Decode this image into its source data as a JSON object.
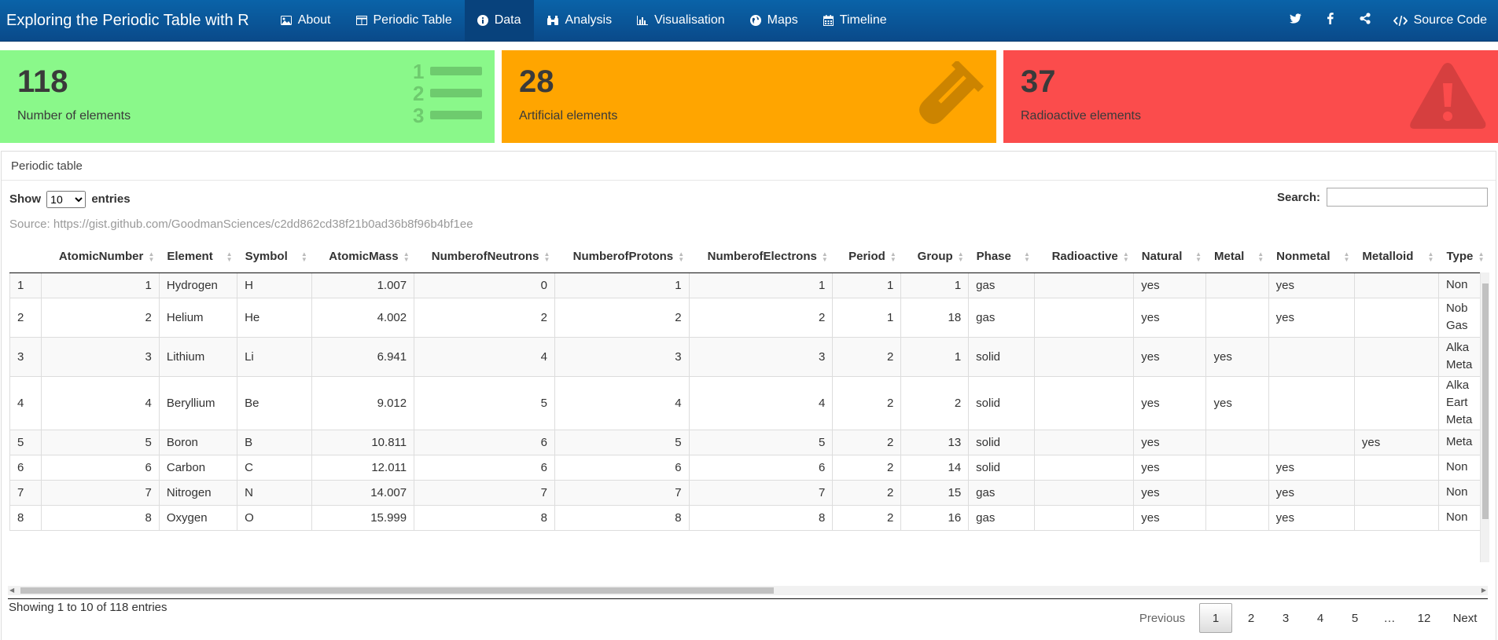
{
  "app": {
    "title": "Exploring the Periodic Table with R"
  },
  "nav": {
    "items": [
      {
        "label": "About",
        "icon": "image-icon"
      },
      {
        "label": "Periodic Table",
        "icon": "table-icon"
      },
      {
        "label": "Data",
        "icon": "info-circle-icon",
        "active": true
      },
      {
        "label": "Analysis",
        "icon": "binoculars-icon"
      },
      {
        "label": "Visualisation",
        "icon": "bar-chart-icon"
      },
      {
        "label": "Maps",
        "icon": "globe-icon"
      },
      {
        "label": "Timeline",
        "icon": "calendar-icon"
      }
    ],
    "right": {
      "twitter_icon": "twitter-icon",
      "facebook_icon": "facebook-icon",
      "share_icon": "share-icon",
      "source_label": "Source Code"
    }
  },
  "value_boxes": [
    {
      "value": "118",
      "label": "Number of elements",
      "color": "#8af88a",
      "icon": "list-ol-icon"
    },
    {
      "value": "28",
      "label": "Artificial elements",
      "color": "#ffa500",
      "icon": "flask-icon"
    },
    {
      "value": "37",
      "label": "Radioactive elements",
      "color": "#fb4c4c",
      "icon": "warning-icon"
    }
  ],
  "card": {
    "title": "Periodic table",
    "show_label": "Show",
    "entries_label": "entries",
    "page_length": "10",
    "search_label": "Search:",
    "search_value": "",
    "source": "Source: https://gist.github.com/GoodmanSciences/c2dd862cd38f21b0ad36b8f96b4bf1ee"
  },
  "table": {
    "columns": [
      "",
      "AtomicNumber",
      "Element",
      "Symbol",
      "AtomicMass",
      "NumberofNeutrons",
      "NumberofProtons",
      "NumberofElectrons",
      "Period",
      "Group",
      "Phase",
      "Radioactive",
      "Natural",
      "Metal",
      "Nonmetal",
      "Metalloid",
      "Type"
    ],
    "rows": [
      [
        "1",
        "1",
        "Hydrogen",
        "H",
        "1.007",
        "0",
        "1",
        "1",
        "1",
        "1",
        "gas",
        "",
        "yes",
        "",
        "yes",
        "",
        "Non"
      ],
      [
        "2",
        "2",
        "Helium",
        "He",
        "4.002",
        "2",
        "2",
        "2",
        "1",
        "18",
        "gas",
        "",
        "yes",
        "",
        "yes",
        "",
        "Nob Gas"
      ],
      [
        "3",
        "3",
        "Lithium",
        "Li",
        "6.941",
        "4",
        "3",
        "3",
        "2",
        "1",
        "solid",
        "",
        "yes",
        "yes",
        "",
        "",
        "Alka Meta"
      ],
      [
        "4",
        "4",
        "Beryllium",
        "Be",
        "9.012",
        "5",
        "4",
        "4",
        "2",
        "2",
        "solid",
        "",
        "yes",
        "yes",
        "",
        "",
        "Alka Eart Meta"
      ],
      [
        "5",
        "5",
        "Boron",
        "B",
        "10.811",
        "6",
        "5",
        "5",
        "2",
        "13",
        "solid",
        "",
        "yes",
        "",
        "",
        "yes",
        "Meta"
      ],
      [
        "6",
        "6",
        "Carbon",
        "C",
        "12.011",
        "6",
        "6",
        "6",
        "2",
        "14",
        "solid",
        "",
        "yes",
        "",
        "yes",
        "",
        "Non"
      ],
      [
        "7",
        "7",
        "Nitrogen",
        "N",
        "14.007",
        "7",
        "7",
        "7",
        "2",
        "15",
        "gas",
        "",
        "yes",
        "",
        "yes",
        "",
        "Non"
      ],
      [
        "8",
        "8",
        "Oxygen",
        "O",
        "15.999",
        "8",
        "8",
        "8",
        "2",
        "16",
        "gas",
        "",
        "yes",
        "",
        "yes",
        "",
        "Non"
      ]
    ]
  },
  "footer": {
    "info": "Showing 1 to 10 of 118 entries",
    "pagination": {
      "previous": "Previous",
      "pages": [
        "1",
        "2",
        "3",
        "4",
        "5",
        "…",
        "12"
      ],
      "current": "1",
      "next": "Next"
    }
  }
}
